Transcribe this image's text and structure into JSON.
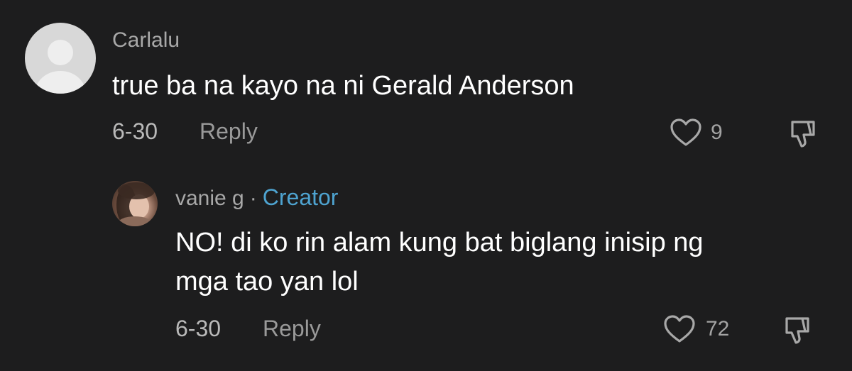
{
  "colors": {
    "background": "#1d1d1e",
    "creator_accent": "#4ea3d0"
  },
  "comment": {
    "username": "Carlalu",
    "text": "true ba na kayo na ni Gerald Anderson",
    "date": "6-30",
    "reply_label": "Reply",
    "like_count": "9",
    "avatar_icon": "default-avatar-icon",
    "like_icon": "heart-icon",
    "dislike_icon": "dislike-icon"
  },
  "reply": {
    "username": "vanie g",
    "separator": "·",
    "badge": "Creator",
    "text_line1": "NO! di ko rin alam kung bat biglang inisip ng",
    "text_line2": "mga tao yan lol",
    "date": "6-30",
    "reply_label": "Reply",
    "like_count": "72",
    "avatar_icon": "user-photo-avatar",
    "like_icon": "heart-icon",
    "dislike_icon": "dislike-icon"
  }
}
